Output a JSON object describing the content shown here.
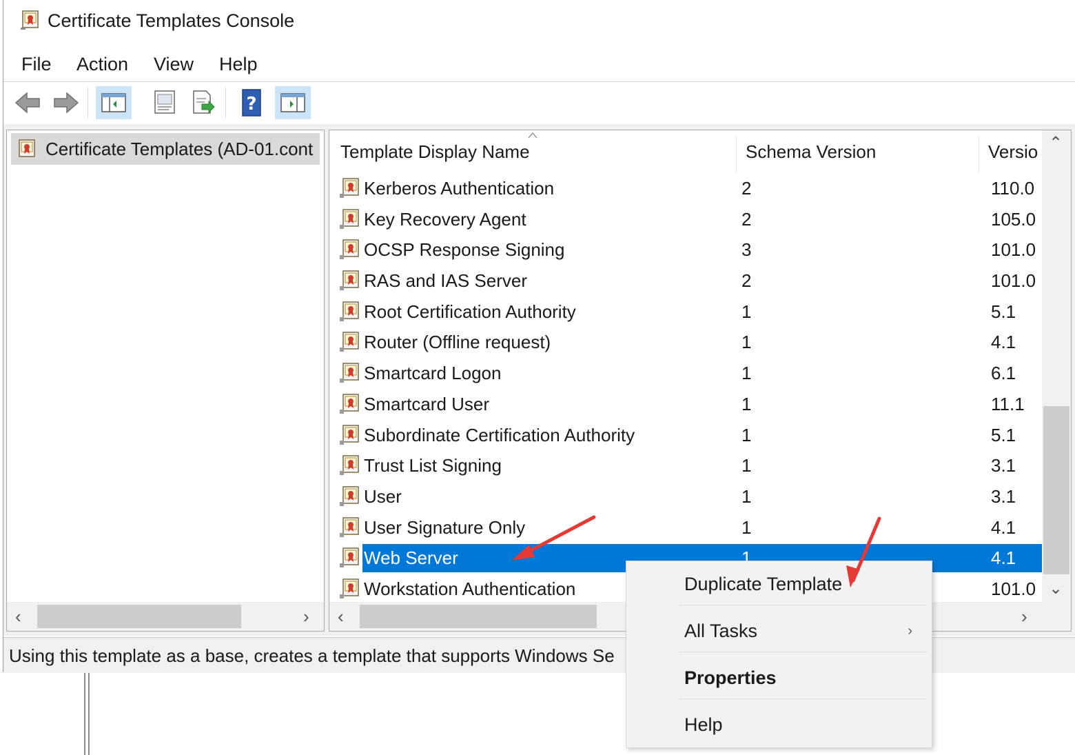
{
  "window": {
    "title": "Certificate Templates Console",
    "icon": "certificate-templates-icon"
  },
  "menubar": {
    "items": [
      "File",
      "Action",
      "View",
      "Help"
    ]
  },
  "toolbar": {
    "buttons": [
      "back-arrow-icon",
      "forward-arrow-icon",
      "show-hide-console-tree-icon",
      "properties-icon",
      "export-list-icon",
      "help-icon",
      "show-hide-action-pane-icon"
    ]
  },
  "tree": {
    "root_label": "Certificate Templates (AD-01.cont"
  },
  "list": {
    "columns": [
      "Template Display Name",
      "Schema Version",
      "Versio"
    ],
    "rows": [
      {
        "name": "Kerberos Authentication",
        "schema": "2",
        "version": "110.0"
      },
      {
        "name": "Key Recovery Agent",
        "schema": "2",
        "version": "105.0"
      },
      {
        "name": "OCSP Response Signing",
        "schema": "3",
        "version": "101.0"
      },
      {
        "name": "RAS and IAS Server",
        "schema": "2",
        "version": "101.0"
      },
      {
        "name": "Root Certification Authority",
        "schema": "1",
        "version": "5.1"
      },
      {
        "name": "Router (Offline request)",
        "schema": "1",
        "version": "4.1"
      },
      {
        "name": "Smartcard Logon",
        "schema": "1",
        "version": "6.1"
      },
      {
        "name": "Smartcard User",
        "schema": "1",
        "version": "11.1"
      },
      {
        "name": "Subordinate Certification Authority",
        "schema": "1",
        "version": "5.1"
      },
      {
        "name": "Trust List Signing",
        "schema": "1",
        "version": "3.1"
      },
      {
        "name": "User",
        "schema": "1",
        "version": "3.1"
      },
      {
        "name": "User Signature Only",
        "schema": "1",
        "version": "4.1"
      },
      {
        "name": "Web Server",
        "schema": "1",
        "version": "4.1",
        "selected": true
      },
      {
        "name": "Workstation Authentication",
        "schema": "",
        "version": "101.0"
      }
    ]
  },
  "context_menu": {
    "items": [
      {
        "label": "Duplicate Template"
      },
      {
        "label": "All Tasks",
        "submenu": true
      },
      {
        "label": "Properties",
        "bold": true
      },
      {
        "label": "Help"
      }
    ]
  },
  "statusbar": {
    "text": "Using this template as a base, creates a template that supports Windows Se"
  },
  "colors": {
    "selection": "#0078d7",
    "annotation_arrow": "#e53935",
    "toolbar_active": "#cce4f7"
  }
}
